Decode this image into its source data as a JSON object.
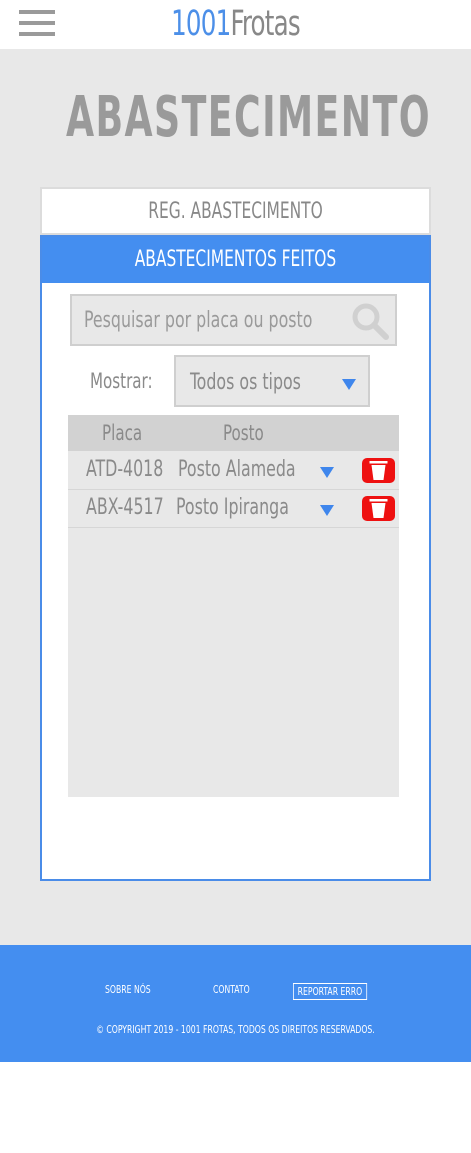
{
  "header": {
    "brand_number": "1001",
    "brand_word": "Frotas"
  },
  "page": {
    "title": "ABASTECIMENTO"
  },
  "tabs": {
    "register_label": "REG. ABASTECIMENTO",
    "done_label": "ABASTECIMENTOS FEITOS"
  },
  "search": {
    "placeholder": "Pesquisar por placa ou posto",
    "icon": "search-icon"
  },
  "filter": {
    "label": "Mostrar:",
    "selected": "Todos os tipos"
  },
  "table": {
    "columns": [
      "Placa",
      "Posto"
    ],
    "rows": [
      {
        "placa": "ATD-4018",
        "posto": "Posto Alameda"
      },
      {
        "placa": "ABX-4517",
        "posto": "Posto Ipiranga"
      }
    ]
  },
  "footer": {
    "links": [
      "SOBRE NÓS",
      "CONTATO",
      "REPORTAR ERRO"
    ],
    "copyright": "© COPYRIGHT 2019 - 1001 FROTAS, TODOS OS DIREITOS RESERVADOS."
  },
  "colors": {
    "accent": "#448ef0",
    "delete": "#ee1111",
    "background": "#e8e8e8"
  }
}
